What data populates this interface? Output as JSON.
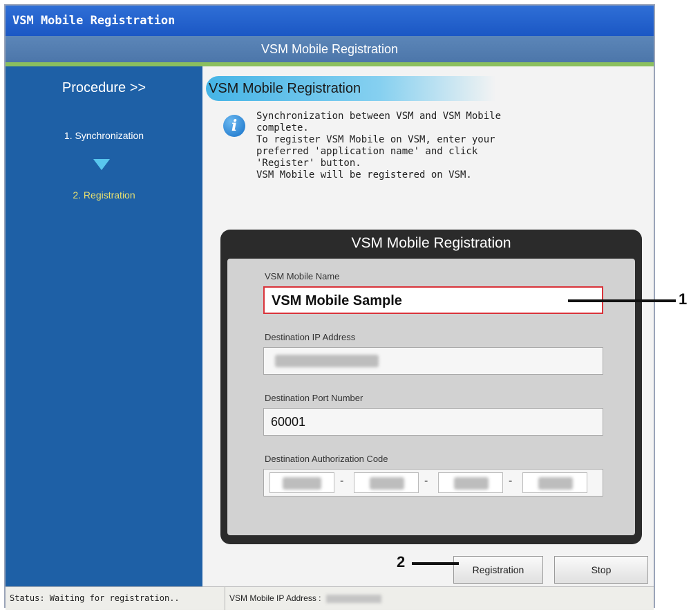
{
  "window": {
    "title": "VSM Mobile Registration"
  },
  "header": {
    "title": "VSM Mobile Registration"
  },
  "sidebar": {
    "procedure_label": "Procedure >>",
    "steps": [
      {
        "label": "1. Synchronization"
      },
      {
        "label": "2. Registration",
        "active": true
      }
    ],
    "arrow_color": "#59c6ee"
  },
  "main": {
    "section_title": "VSM Mobile Registration",
    "info_icon": "info-icon",
    "info_text": "Synchronization between VSM and VSM Mobile\ncomplete.\nTo register VSM Mobile on VSM, enter your\npreferred 'application name' and click\n'Register' button.\nVSM Mobile will be registered on VSM.",
    "panel": {
      "title": "VSM Mobile Registration",
      "mobile_name_label": "VSM Mobile Name",
      "mobile_name_value": "VSM Mobile Sample",
      "ip_label": "Destination IP Address",
      "port_label": "Destination Port Number",
      "port_value": "60001",
      "auth_label": "Destination Authorization Code",
      "auth_separator": "-"
    },
    "buttons": {
      "registration": "Registration",
      "stop": "Stop"
    }
  },
  "statusbar": {
    "status": "Status: Waiting for registration..",
    "ip_label": "VSM Mobile IP Address :"
  },
  "callouts": {
    "one": "1",
    "two": "2"
  },
  "colors": {
    "accent_blue": "#1e60a6",
    "active_border": "#d9333a",
    "active_step": "#e8e070"
  }
}
